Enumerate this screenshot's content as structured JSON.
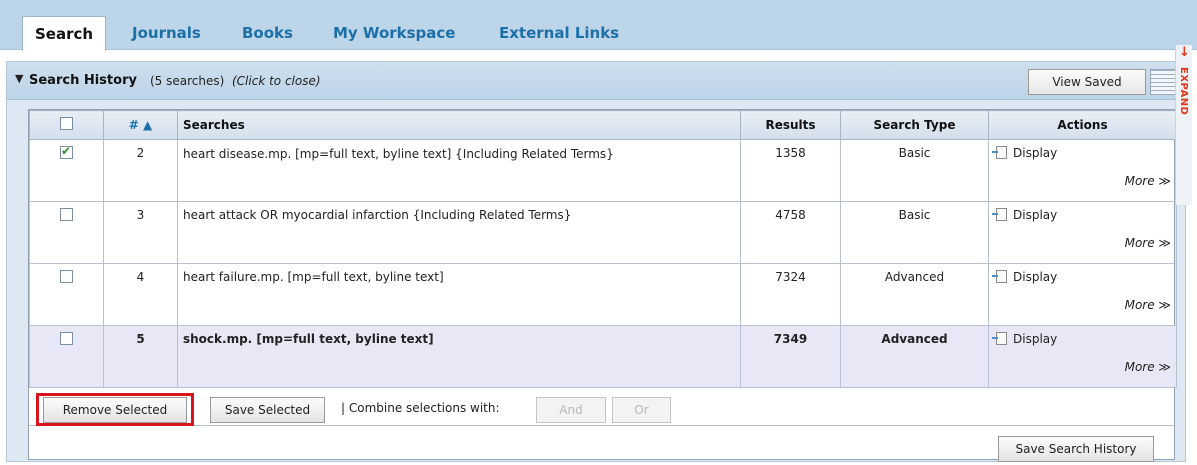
{
  "tabs": [
    {
      "label": "Search",
      "active": true
    },
    {
      "label": "Journals",
      "active": false
    },
    {
      "label": "Books",
      "active": false
    },
    {
      "label": "My Workspace",
      "active": false
    },
    {
      "label": "External Links",
      "active": false
    }
  ],
  "history": {
    "title": "Search History",
    "count_text": "(5 searches)",
    "hint": "(Click to close)",
    "view_saved_label": "View Saved"
  },
  "table": {
    "headers": {
      "num": "# ▲",
      "searches": "Searches",
      "results": "Results",
      "type": "Search Type",
      "actions": "Actions"
    },
    "rows": [
      {
        "num": "2",
        "query": "heart disease.mp. [mp=full text, byline text] {Including Related Terms}",
        "results": "1358",
        "type": "Basic",
        "checked": true,
        "highlighted": false
      },
      {
        "num": "3",
        "query": "heart attack OR myocardial infarction {Including Related Terms}",
        "results": "4758",
        "type": "Basic",
        "checked": false,
        "highlighted": false
      },
      {
        "num": "4",
        "query": "heart failure.mp. [mp=full text, byline text]",
        "results": "7324",
        "type": "Advanced",
        "checked": false,
        "highlighted": false
      },
      {
        "num": "5",
        "query": "shock.mp. [mp=full text, byline text]",
        "results": "7349",
        "type": "Advanced",
        "checked": false,
        "highlighted": true
      }
    ],
    "display_label": "Display",
    "more_label": "More ≫"
  },
  "controls": {
    "remove_selected": "Remove Selected",
    "save_selected": "Save Selected",
    "combine_label": "| Combine selections with:",
    "and_label": "And",
    "or_label": "Or",
    "save_history": "Save Search History"
  },
  "expand": {
    "label": "EXPAND",
    "arrow": "↓"
  },
  "colors": {
    "accent": "#1d6fa8",
    "highlight_box": "#d8141c",
    "expand": "#e0381b"
  }
}
